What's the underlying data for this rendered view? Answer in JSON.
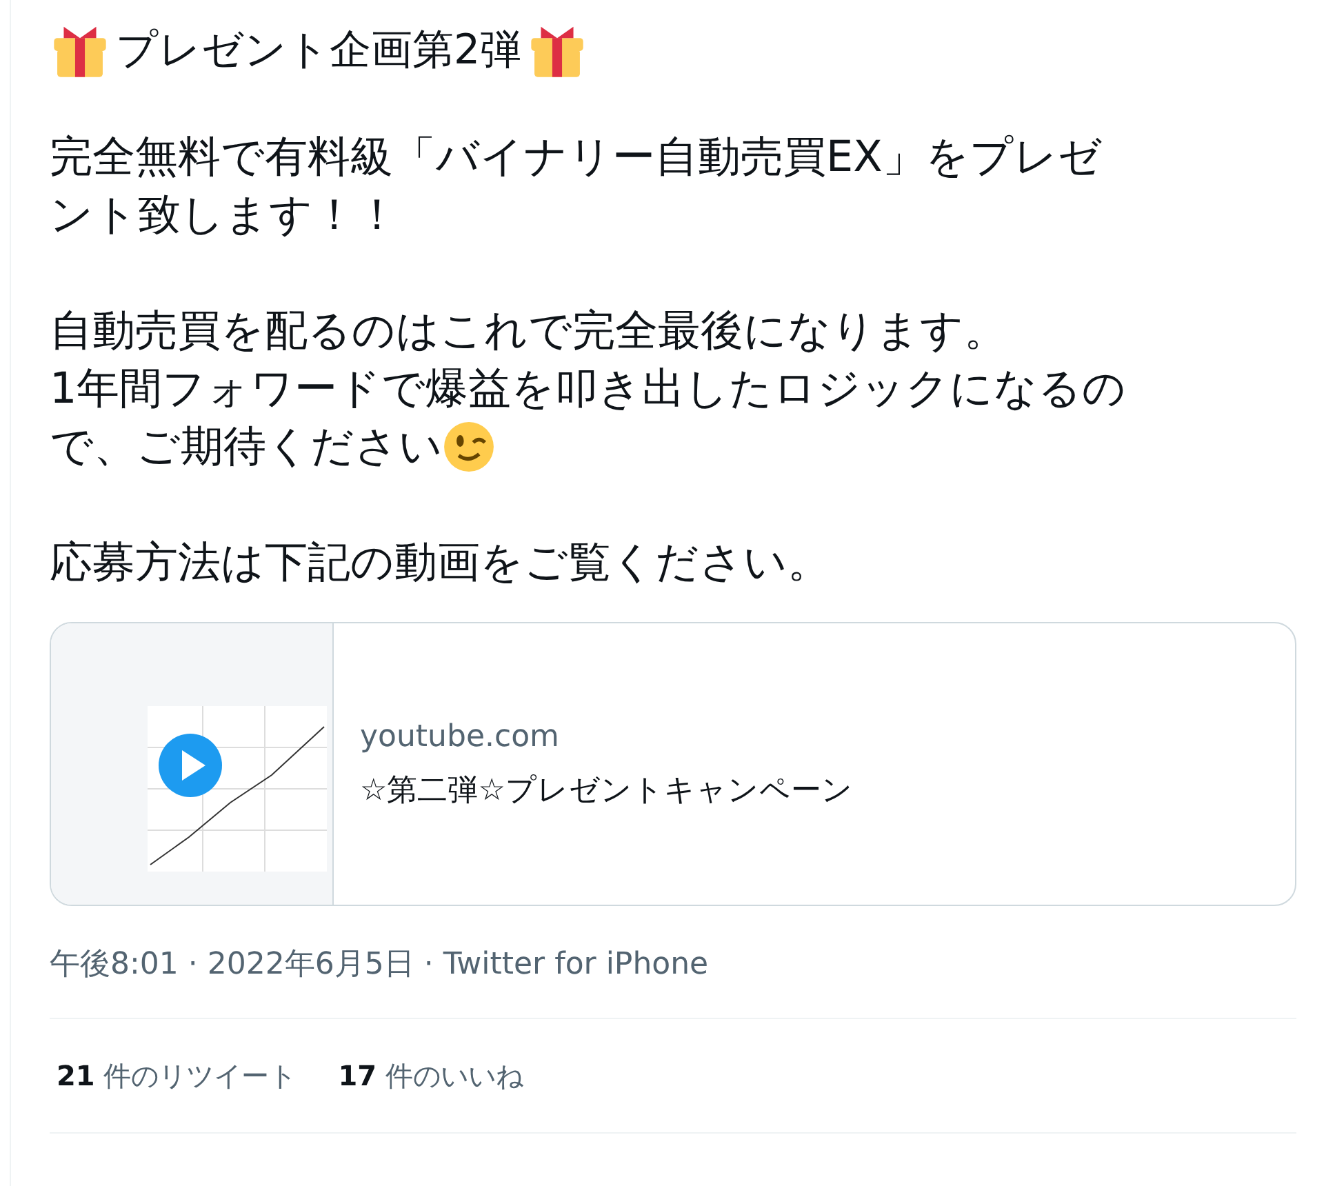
{
  "tweet": {
    "title": "プレゼント企画第2弾",
    "paragraphs": [
      [
        "完全無料で有料級「バイナリー自動売買EX」をプレゼ",
        "ント致します！！"
      ],
      [
        "自動売買を配るのはこれで完全最後になります。",
        "1年間フォワードで爆益を叩き出したロジックになるの",
        "で、ご期待ください"
      ],
      [
        "応募方法は下記の動画をご覧ください。"
      ]
    ],
    "card": {
      "domain": "youtube.com",
      "title": "☆第二弾☆プレゼントキャンペーン"
    },
    "meta": "午後8:01 · 2022年6月5日 · Twitter for iPhone",
    "stats": [
      {
        "count": "21",
        "label": "件のリツイート"
      },
      {
        "count": "17",
        "label": "件のいいね"
      }
    ]
  }
}
